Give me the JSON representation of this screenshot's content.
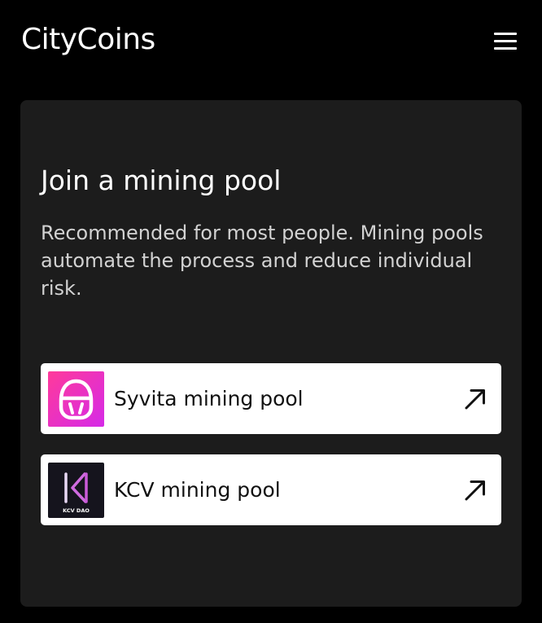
{
  "header": {
    "logo_text": "CityCoins",
    "menu_icon": "hamburger-menu-icon"
  },
  "card": {
    "title": "Join a mining pool",
    "description": "Recommended for most people. Mining pools automate the process and reduce individual risk."
  },
  "pools": [
    {
      "name": "Syvita mining pool",
      "logo_icon": "syvita-logo",
      "logo_colors": [
        "#ff2fa4",
        "#d42be6"
      ],
      "action_icon": "arrow-up-right-icon"
    },
    {
      "name": "KCV mining pool",
      "logo_icon": "kcv-dao-logo",
      "logo_text": "KCV DAO",
      "logo_colors": [
        "#14131c",
        "#d06be0"
      ],
      "action_icon": "arrow-up-right-icon"
    }
  ],
  "colors": {
    "background": "#000000",
    "card": "#1c1c1c",
    "pool_item": "#ffffff"
  }
}
